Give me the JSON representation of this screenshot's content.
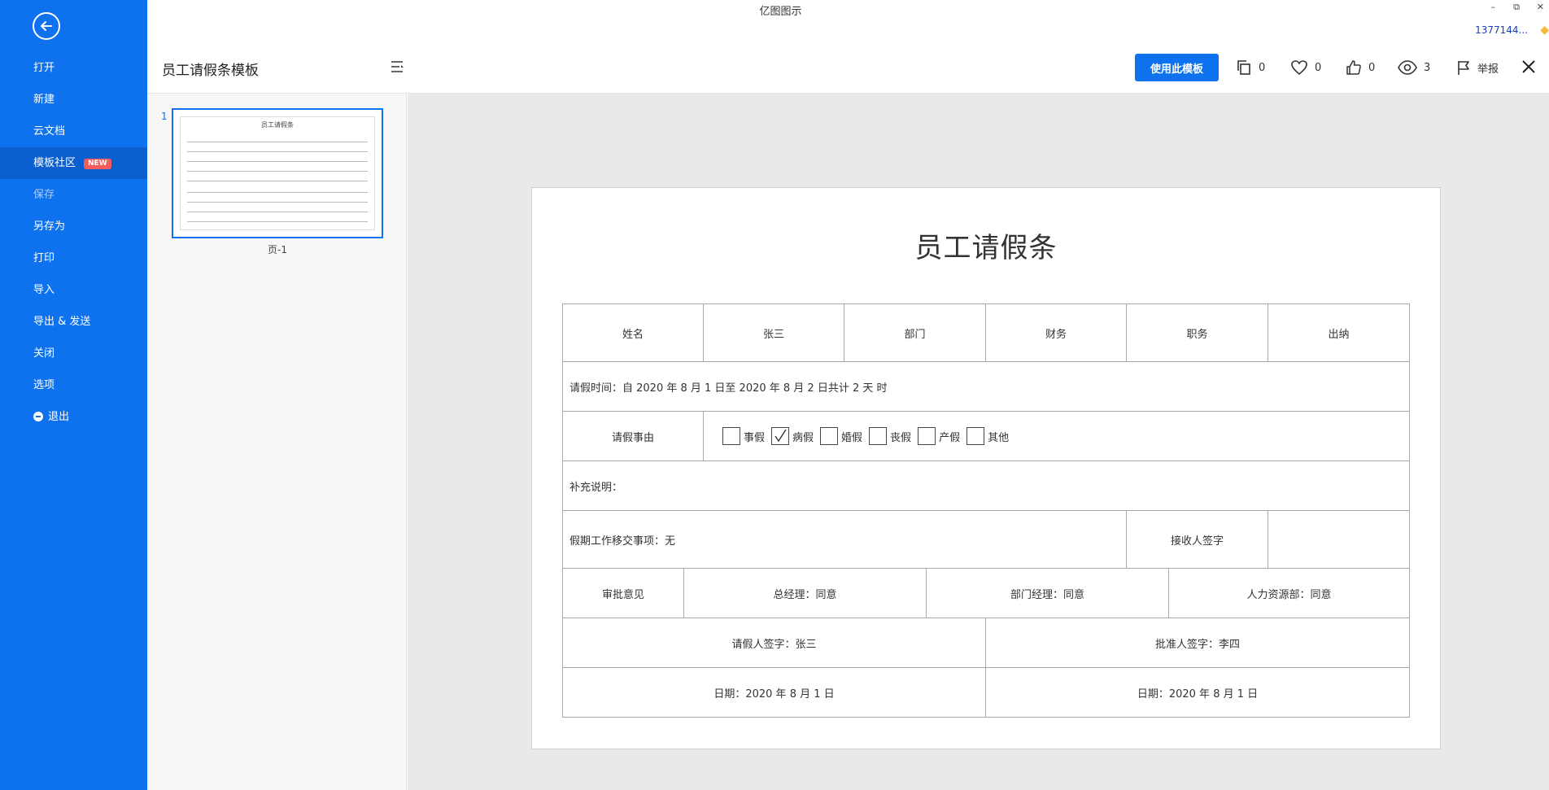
{
  "app": {
    "title": "亿图图示",
    "user": "1377144...",
    "window": {
      "minimize": "–",
      "restore": "⧉",
      "close": "✕"
    }
  },
  "sidebar": {
    "items": [
      {
        "label": "打开",
        "state": "normal"
      },
      {
        "label": "新建",
        "state": "normal"
      },
      {
        "label": "云文档",
        "state": "normal"
      },
      {
        "label": "模板社区",
        "state": "active",
        "badge": "NEW"
      },
      {
        "label": "保存",
        "state": "dim"
      },
      {
        "label": "另存为",
        "state": "normal"
      },
      {
        "label": "打印",
        "state": "normal"
      },
      {
        "label": "导入",
        "state": "normal"
      },
      {
        "label": "导出 & 发送",
        "state": "normal"
      },
      {
        "label": "关闭",
        "state": "normal"
      },
      {
        "label": "选项",
        "state": "normal"
      },
      {
        "label": "退出",
        "state": "normal"
      }
    ]
  },
  "toolbar": {
    "doc_title": "员工请假条模板",
    "use_template": "使用此模板",
    "copies": "0",
    "favorites": "0",
    "likes": "0",
    "views": "3",
    "report": "举报"
  },
  "thumbnails": {
    "page_number": "1",
    "page_label": "页-1",
    "preview_title": "员工请假条"
  },
  "form": {
    "title": "员工请假条",
    "name_label": "姓名",
    "name_value": "张三",
    "dept_label": "部门",
    "dept_value": "财务",
    "position_label": "职务",
    "position_value": "出纳",
    "leave_time": "请假时间：自  2020   年  8  月  1   日至 2020    年  8  月  2   日共计   2  天     时",
    "reason_label": "请假事由",
    "reasons": [
      {
        "label": "事假",
        "checked": false
      },
      {
        "label": "病假",
        "checked": true
      },
      {
        "label": "婚假",
        "checked": false
      },
      {
        "label": "丧假",
        "checked": false
      },
      {
        "label": "产假",
        "checked": false
      },
      {
        "label": "其他",
        "checked": false
      }
    ],
    "supplement": "补充说明：",
    "handover": "假期工作移交事项：无",
    "receiver_label": "接收人签字",
    "receiver_value": "",
    "approval_label": "审批意见",
    "gm_opinion": "总经理：同意",
    "dept_manager_opinion": "部门经理：同意",
    "hr_opinion": "人力资源部：同意",
    "applicant_sign": "请假人签字：张三",
    "approver_sign": "批准人签字：李四",
    "date_left": "日期：2020     年  8  月   1  日",
    "date_right": "日期：2020     年 8    月  1   日"
  },
  "colors": {
    "brand": "#0e72ee",
    "sidebar_active": "#0b5fce",
    "badge": "#f45b5b",
    "vip": "#f6b73c"
  }
}
